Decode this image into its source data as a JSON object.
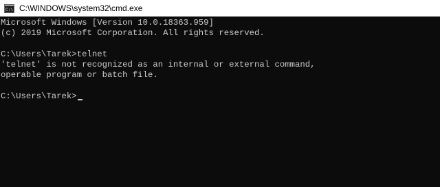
{
  "window": {
    "title": "C:\\WINDOWS\\system32\\cmd.exe",
    "icon": "cmd-icon"
  },
  "console": {
    "lines": [
      "Microsoft Windows [Version 10.0.18363.959]",
      "(c) 2019 Microsoft Corporation. All rights reserved.",
      "",
      "C:\\Users\\Tarek>telnet",
      "'telnet' is not recognized as an internal or external command,",
      "operable program or batch file.",
      ""
    ],
    "prompt": "C:\\Users\\Tarek>"
  },
  "colors": {
    "background": "#0c0c0c",
    "text": "#cccccc",
    "titlebar": "#ffffff"
  }
}
